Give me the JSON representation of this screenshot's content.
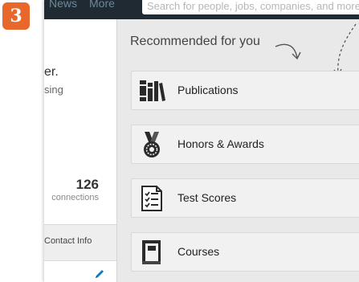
{
  "step_number": "3",
  "nav": {
    "news": "News",
    "more": "More"
  },
  "search": {
    "placeholder": "Search for people, jobs, companies, and more..."
  },
  "profile": {
    "name_fragment": "er.",
    "headline_fragment": "sing",
    "connections_count": "126",
    "connections_label": "connections",
    "contact_info_label": "Contact Info"
  },
  "recommended": {
    "heading": "Recommended for you",
    "items": [
      {
        "label": "Publications",
        "icon": "books-icon"
      },
      {
        "label": "Honors & Awards",
        "icon": "medal-icon"
      },
      {
        "label": "Test Scores",
        "icon": "checklist-icon"
      },
      {
        "label": "Courses",
        "icon": "book-icon"
      }
    ]
  },
  "colors": {
    "badge": "#e8672a",
    "topbar": "#1f2a33",
    "edit_icon": "#0b7cc3"
  }
}
